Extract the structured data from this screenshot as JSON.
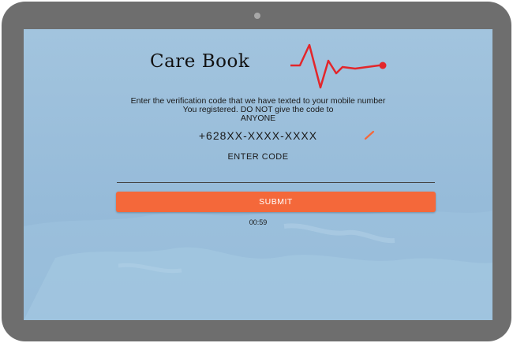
{
  "app": {
    "logo_text": "Care Book",
    "accent_color": "#e3262b"
  },
  "verification": {
    "message_line1": "Enter the verification code that we have texted to your mobile number",
    "message_line2": "You registered. DO NOT give the code to",
    "message_line3": "ANYONE",
    "phone_number": "+628XX-XXXX-XXXX",
    "edit_icon": "pencil-icon",
    "code_label": "ENTER CODE",
    "code_value": "",
    "submit_label": "SUBMIT",
    "timer": "00:59"
  },
  "colors": {
    "submit_bg": "#f4683a",
    "screen_bg": "#9fc2dd",
    "device_frame": "#6e6e6e"
  }
}
